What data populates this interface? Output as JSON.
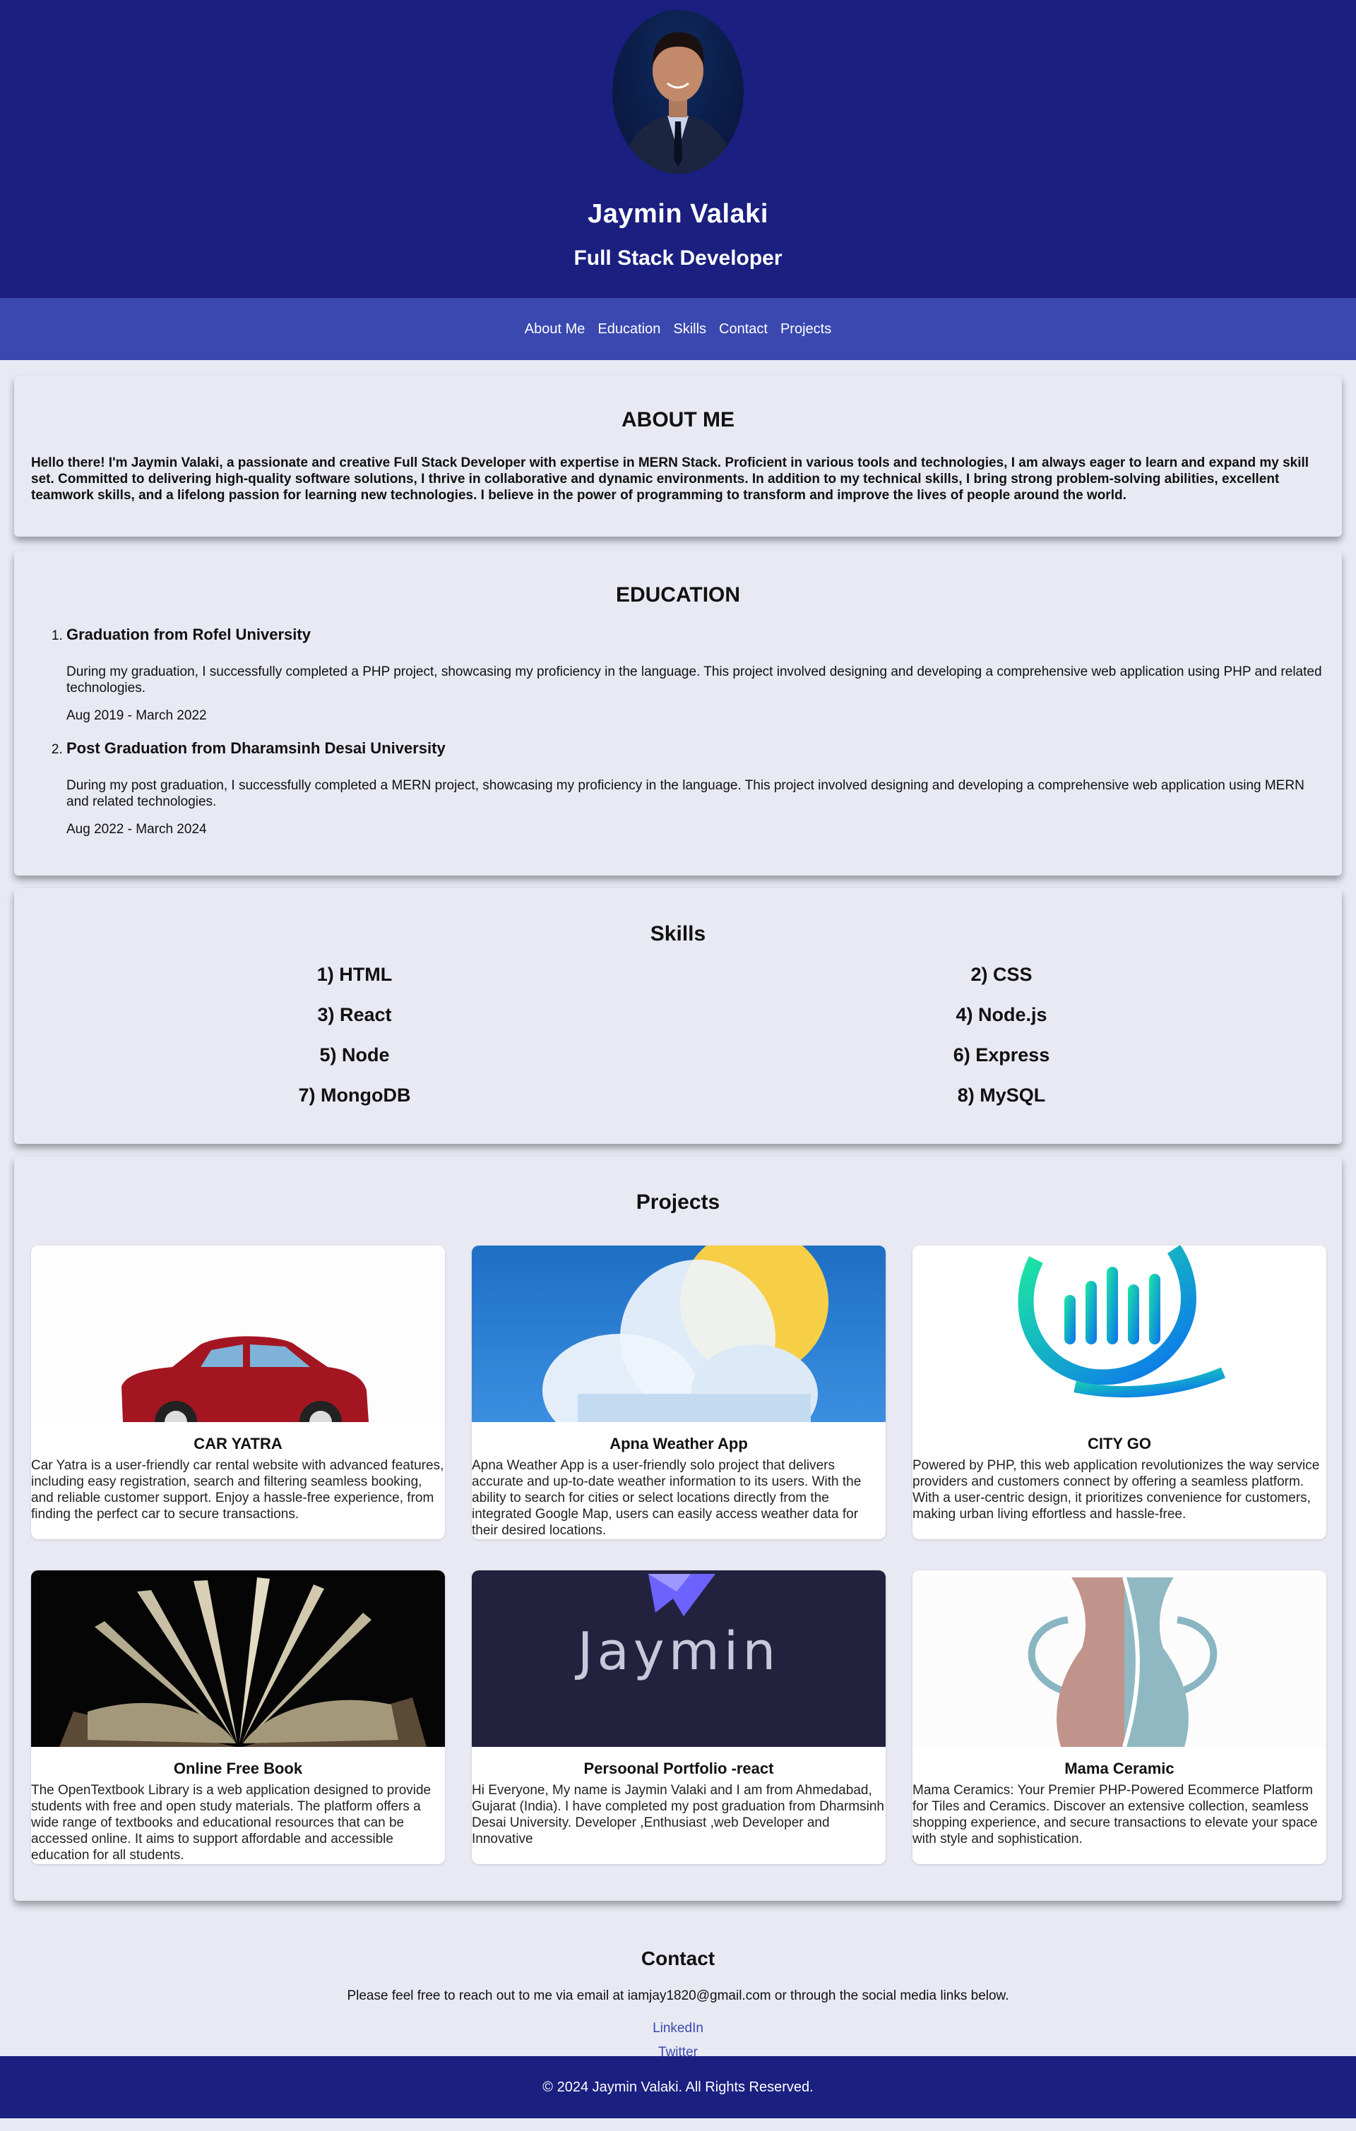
{
  "header": {
    "name": "Jaymin Valaki",
    "role": "Full Stack Developer"
  },
  "nav": {
    "items": [
      "About Me",
      "Education",
      "Skills",
      "Contact",
      "Projects"
    ]
  },
  "about": {
    "title": "ABOUT ME",
    "text": "Hello there! I'm Jaymin Valaki, a passionate and creative Full Stack Developer with expertise in MERN Stack. Proficient in various tools and technologies, I am always eager to learn and expand my skill set. Committed to delivering high-quality software solutions, I thrive in collaborative and dynamic environments. In addition to my technical skills, I bring strong problem-solving abilities, excellent teamwork skills, and a lifelong passion for learning new technologies. I believe in the power of programming to transform and improve the lives of people around the world."
  },
  "education": {
    "title": "EDUCATION",
    "items": [
      {
        "heading": "Graduation from Rofel University",
        "text": "During my graduation, I successfully completed a PHP project, showcasing my proficiency in the language. This project involved designing and developing a comprehensive web application using PHP and related technologies.",
        "dates": "Aug 2019 - March 2022"
      },
      {
        "heading": "Post Graduation from Dharamsinh Desai University",
        "text": "During my post graduation, I successfully completed a MERN project, showcasing my proficiency in the language. This project involved designing and developing a comprehensive web application using MERN and related technologies.",
        "dates": "Aug 2022 - March 2024"
      }
    ]
  },
  "skills": {
    "title": "Skills",
    "items": [
      "1) HTML",
      "2) CSS",
      "3) React",
      "4) Node.js",
      "5) Node",
      "6) Express",
      "7) MongoDB",
      "8) MySQL"
    ]
  },
  "projects": {
    "title": "Projects",
    "items": [
      {
        "title": "CAR YATRA",
        "text": "Car Yatra is a user-friendly car rental website with advanced features, including easy registration, search and filtering seamless booking, and reliable customer support. Enjoy a hassle-free experience, from finding the perfect car to secure transactions.",
        "icon": "car-image"
      },
      {
        "title": "Apna Weather App",
        "text": "Apna Weather App is a user-friendly solo project that delivers accurate and up-to-date weather information to its users. With the ability to search for cities or select locations directly from the integrated Google Map, users can easily access weather data for their desired locations.",
        "icon": "weather-image"
      },
      {
        "title": "CITY GO",
        "text": "Powered by PHP, this web application revolutionizes the way service providers and customers connect by offering a seamless platform. With a user-centric design, it prioritizes convenience for customers, making urban living effortless and hassle-free.",
        "icon": "city-go-logo-image"
      },
      {
        "title": "Online Free Book",
        "text": "The OpenTextbook Library is a web application designed to provide students with free and open study materials. The platform offers a wide range of textbooks and educational resources that can be accessed online. It aims to support affordable and accessible education for all students.",
        "icon": "book-image"
      },
      {
        "title": "Persoonal Portfolio -react",
        "text": "Hi Everyone, My name is Jaymin Valaki and I am from Ahmedabad, Gujarat (India). I have completed my post graduation from Dharmsinh Desai University. Developer ,Enthusiast ,web Developer and Innovative",
        "icon": "portfolio-logo-image",
        "logo_text": "Jaymin"
      },
      {
        "title": "Mama Ceramic",
        "text": "Mama Ceramics: Your Premier PHP-Powered Ecommerce Platform for Tiles and Ceramics. Discover an extensive collection, seamless shopping experience, and secure transactions to elevate your space with style and sophistication.",
        "icon": "vase-image"
      }
    ]
  },
  "contact": {
    "title": "Contact",
    "text": "Please feel free to reach out to me via email at iamjay1820@gmail.com or through the social media links below.",
    "linkedin": "LinkedIn",
    "twitter": "Twitter"
  },
  "footer": {
    "text": "© 2024 Jaymin Valaki. All Rights Reserved."
  },
  "colors": {
    "header_bg": "#1a1f80",
    "nav_bg": "#3a48b0",
    "page_bg": "#e8e9f3"
  }
}
